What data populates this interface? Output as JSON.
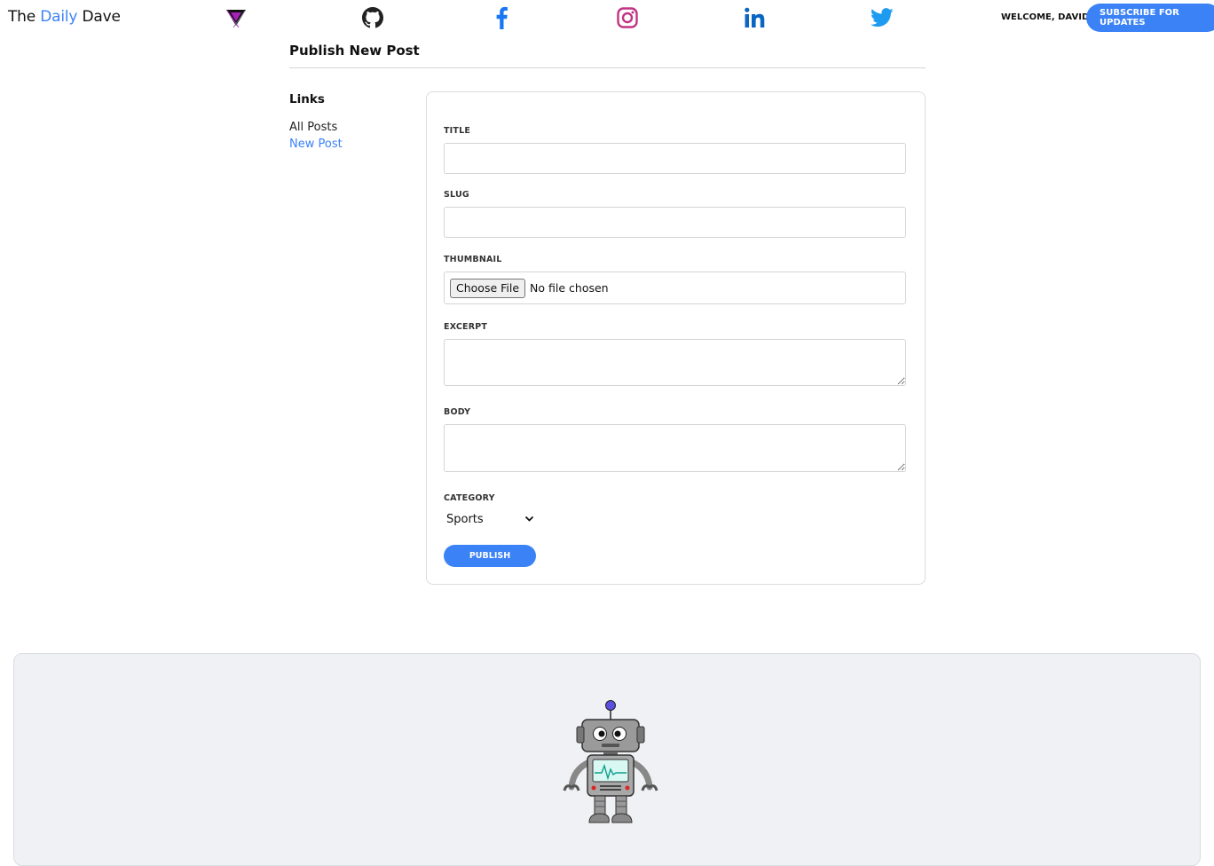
{
  "header": {
    "brand": {
      "part1": "The",
      "part2": "Daily",
      "part3": "Dave"
    },
    "welcome": "WELCOME, DAVID!",
    "subscribe_label": "SUBSCRIBE FOR UPDATES",
    "social_icons": [
      "logo-triangle-icon",
      "github-icon",
      "facebook-icon",
      "instagram-icon",
      "linkedin-icon",
      "twitter-icon"
    ],
    "accent_color": "#3b82f6"
  },
  "page": {
    "title": "Publish New Post"
  },
  "sidebar": {
    "heading": "Links",
    "items": [
      {
        "label": "All Posts",
        "active": false
      },
      {
        "label": "New Post",
        "active": true
      }
    ]
  },
  "form": {
    "title_label": "TITLE",
    "title_value": "",
    "slug_label": "SLUG",
    "slug_value": "",
    "thumbnail_label": "THUMBNAIL",
    "choose_file_label": "Choose File",
    "no_file_text": "No file chosen",
    "excerpt_label": "EXCERPT",
    "excerpt_value": "",
    "body_label": "BODY",
    "body_value": "",
    "category_label": "CATEGORY",
    "category_selected": "Sports",
    "publish_label": "PUBLISH"
  },
  "footer": {
    "mascot": "robot-icon"
  }
}
